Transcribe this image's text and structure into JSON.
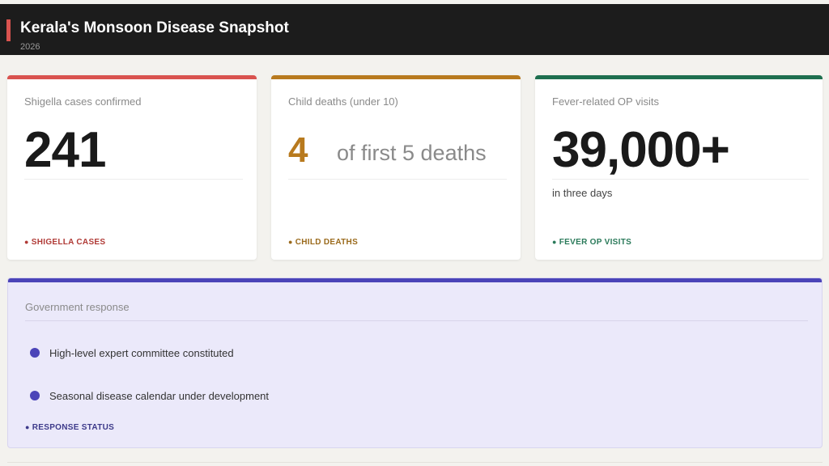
{
  "header": {
    "title": "Kerala's Monsoon Disease Snapshot",
    "subtitle": "2026",
    "accent_color": "#d9534f"
  },
  "cards": [
    {
      "label": "Shigella cases confirmed",
      "value": "241",
      "note": "",
      "tag": "SHIGELLA CASES",
      "color": "#d9534f",
      "tag_color": "#b03a36"
    },
    {
      "label": "Child deaths (under 10)",
      "value": "4",
      "value_suffix": "of first 5 deaths",
      "tag": "CHILD DEATHS",
      "color": "#b87a1e",
      "tag_color": "#9a6a1c"
    },
    {
      "label": "Fever-related OP visits",
      "value": "39,000+",
      "note": "in three days",
      "tag": "FEVER OP VISITS",
      "color": "#1e6f4f",
      "tag_color": "#2a7a5a"
    }
  ],
  "response": {
    "label": "Government response",
    "items": [
      "High-level expert committee constituted",
      "Seasonal disease calendar under development"
    ],
    "tag": "RESPONSE STATUS",
    "color": "#4b44b8",
    "bullet_color": "#4b44b8"
  }
}
